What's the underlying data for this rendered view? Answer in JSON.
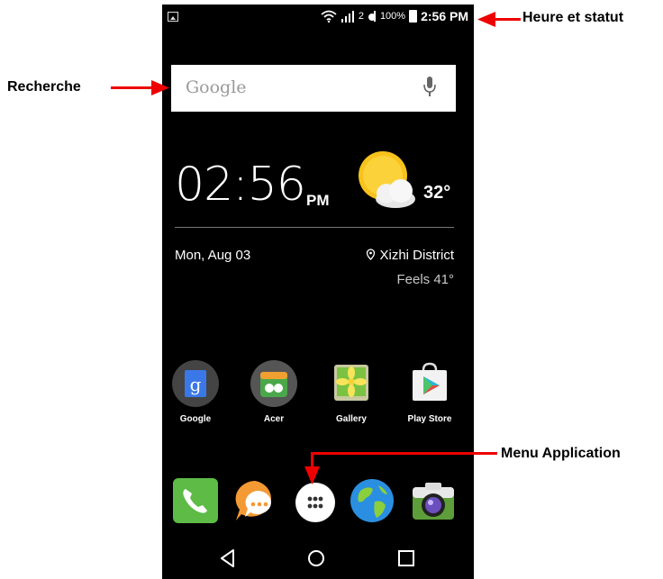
{
  "status_bar": {
    "time": "2:56 PM",
    "battery": "100%",
    "sim_slot": "2"
  },
  "search": {
    "placeholder": "Google"
  },
  "clock_widget": {
    "time": "02:56",
    "ampm": "PM",
    "temperature": "32°",
    "date": "Mon, Aug 03",
    "location": "Xizhi District",
    "feels_like": "Feels 41°"
  },
  "apps": [
    {
      "label": "Google",
      "icon": "google-search-icon"
    },
    {
      "label": "Acer",
      "icon": "acer-icon"
    },
    {
      "label": "Gallery",
      "icon": "gallery-icon"
    },
    {
      "label": "Play Store",
      "icon": "play-store-icon"
    }
  ],
  "dock": [
    {
      "icon": "phone-icon"
    },
    {
      "icon": "messaging-icon"
    },
    {
      "icon": "app-drawer-icon"
    },
    {
      "icon": "browser-icon"
    },
    {
      "icon": "camera-icon"
    }
  ],
  "annotations": {
    "status": "Heure et statut",
    "search": "Recherche",
    "menu": "Menu Application"
  },
  "colors": {
    "arrow": "#e00000",
    "phone_bg": "#000000"
  }
}
